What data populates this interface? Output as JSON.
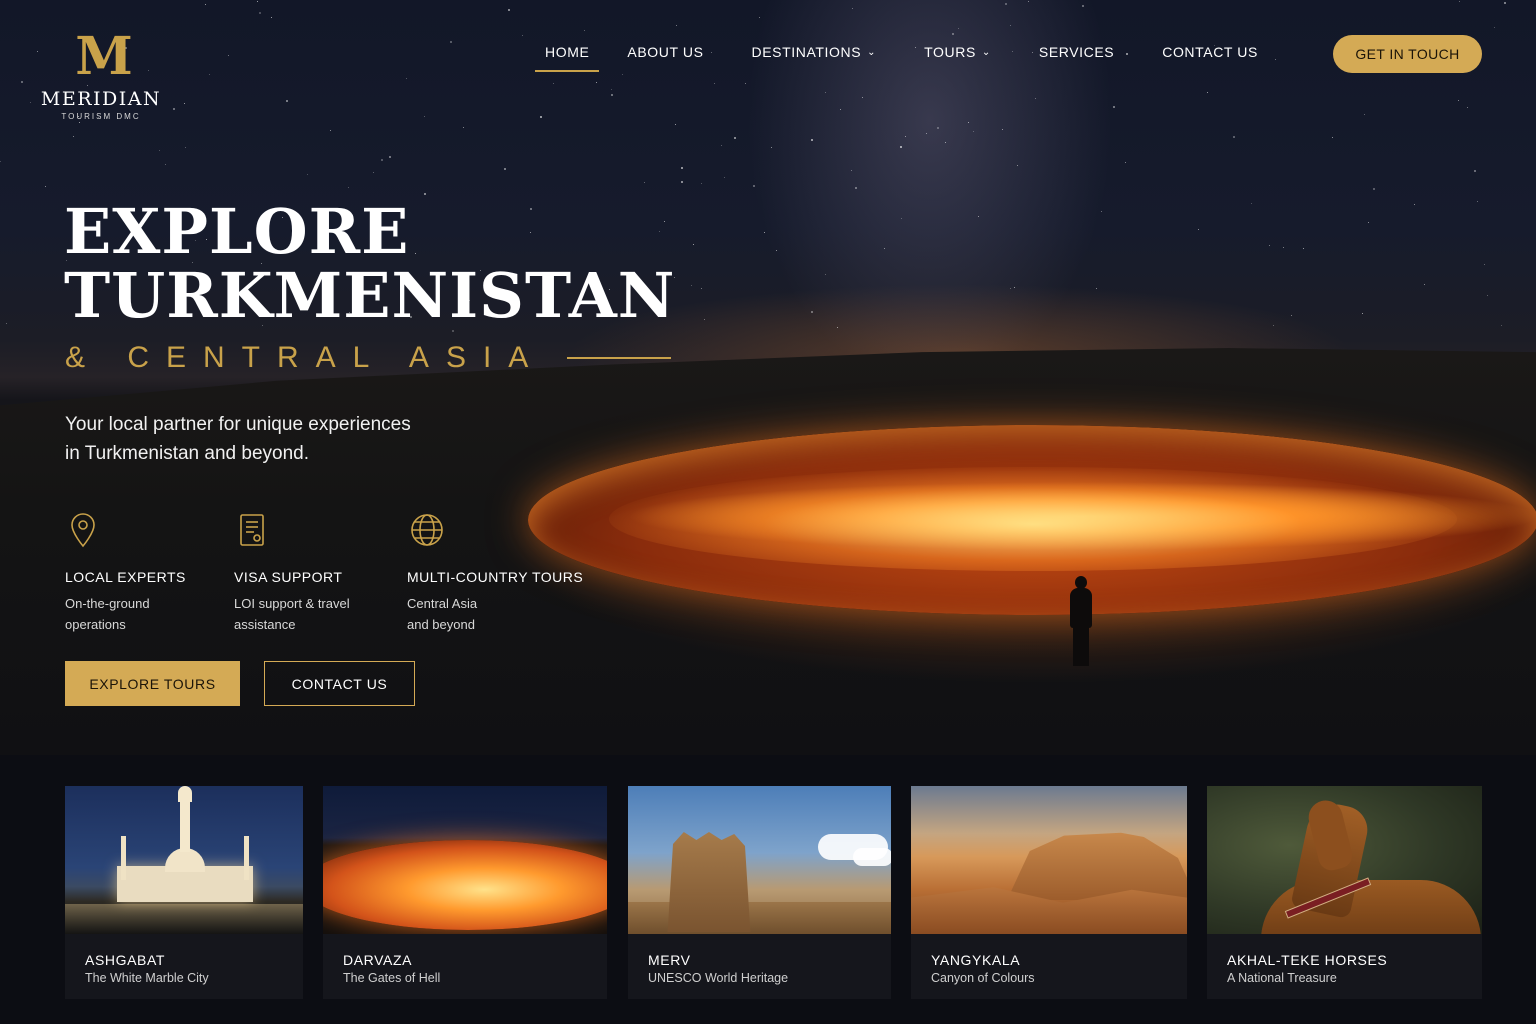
{
  "brand": {
    "mark": "M",
    "name": "MERIDIAN",
    "tagline": "TOURISM DMC"
  },
  "nav": {
    "items": [
      {
        "label": "HOME",
        "active": true,
        "dropdown": false
      },
      {
        "label": "ABOUT US",
        "active": false,
        "dropdown": false
      },
      {
        "label": "DESTINATIONS",
        "active": false,
        "dropdown": true
      },
      {
        "label": "TOURS",
        "active": false,
        "dropdown": true
      },
      {
        "label": "SERVICES",
        "active": false,
        "dropdown": false
      },
      {
        "label": "CONTACT US",
        "active": false,
        "dropdown": false
      }
    ],
    "cta": "GET IN TOUCH"
  },
  "hero": {
    "title_line1": "EXPLORE",
    "title_line2": "TURKMENISTAN",
    "subtitle": "& CENTRAL ASIA",
    "lead_line1": "Your local partner for unique experiences",
    "lead_line2": "in Turkmenistan and beyond.",
    "features": [
      {
        "icon": "map-pin-icon",
        "title": "LOCAL EXPERTS",
        "desc_line1": "On-the-ground",
        "desc_line2": "operations"
      },
      {
        "icon": "document-icon",
        "title": "VISA SUPPORT",
        "desc_line1": "LOI support & travel",
        "desc_line2": "assistance"
      },
      {
        "icon": "globe-icon",
        "title": "MULTI-COUNTRY TOURS",
        "desc_line1": "Central Asia",
        "desc_line2": "and beyond"
      }
    ],
    "primary_button": "EXPLORE TOURS",
    "secondary_button": "CONTACT US"
  },
  "destinations": [
    {
      "title": "ASHGABAT",
      "subtitle": "The White Marble City"
    },
    {
      "title": "DARVAZA",
      "subtitle": "The Gates of Hell"
    },
    {
      "title": "MERV",
      "subtitle": "UNESCO World Heritage"
    },
    {
      "title": "YANGYKALA",
      "subtitle": "Canyon of Colours"
    },
    {
      "title": "AKHAL-TEKE HORSES",
      "subtitle": "A National Treasure"
    }
  ],
  "colors": {
    "accent_gold": "#d4aa55",
    "background_dark": "#0c0d13",
    "card_bg": "#15161c"
  }
}
